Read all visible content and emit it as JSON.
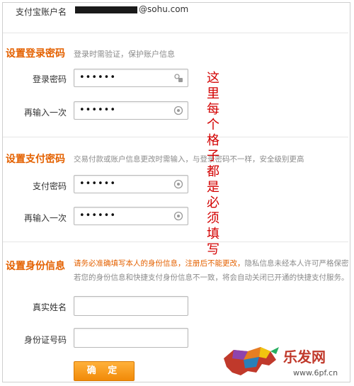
{
  "account": {
    "label": "支付宝账户名",
    "value_suffix": "@sohu.com"
  },
  "login_password": {
    "title": "设置登录密码",
    "hint": "登录时需验证，保护账户信息",
    "field1_label": "登录密码",
    "field1_value": "••••••",
    "field2_label": "再输入一次",
    "field2_value": "••••••"
  },
  "pay_password": {
    "title": "设置支付密码",
    "hint": "交易付款或账户信息更改时需输入，与登录密码不一样，安全级别更高",
    "field1_label": "支付密码",
    "field1_value": "••••••",
    "field2_label": "再输入一次",
    "field2_value": "••••••"
  },
  "identity": {
    "title": "设置身份信息",
    "hint_red": "请务必准确填写本人的身份信息，注册后不能更改，",
    "hint_gray1": "隐私信息未经本人许可严格保密",
    "hint_gray2": "若您的身份信息和快捷支付身份信息不一致，将会自动关闭已开通的快捷支付服务。",
    "name_label": "真实姓名",
    "name_value": "",
    "id_label": "身份证号码",
    "id_value": ""
  },
  "confirm_button": "确 定",
  "annotation": "这里每个格子都是必须填写",
  "watermark": {
    "brand": "乐发网",
    "url": "www.6pf.cn"
  },
  "colors": {
    "accent": "#e46100",
    "annotation": "#d30000",
    "button": "#f39a1e"
  }
}
